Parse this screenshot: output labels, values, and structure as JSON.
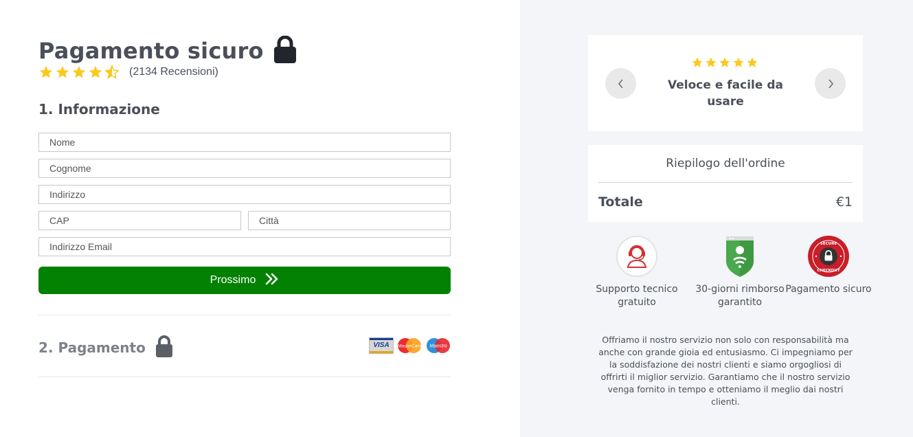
{
  "checkout": {
    "title": "Pagamento sicuro",
    "rating": 4.5,
    "reviews_text": "(2134 Recensioni)",
    "section1_title": "1. Informazione",
    "fields": {
      "nome": "Nome",
      "cognome": "Cognome",
      "indirizzo": "Indirizzo",
      "cap": "CAP",
      "citta": "Città",
      "email": "Indirizzo Email"
    },
    "next_button": "Prossimo",
    "section2_title": "2. Pagamento",
    "card_brands": [
      "VISA",
      "MasterCard",
      "Maestro"
    ]
  },
  "review_slider": {
    "stars": 5,
    "text": "Veloce e facile da usare"
  },
  "order_summary": {
    "title": "Riepilogo dell'ordine",
    "total_label": "Totale",
    "total_value": "€1"
  },
  "badges": [
    {
      "icon": "support-agent-icon",
      "label": "Supporto tecnico gratuito"
    },
    {
      "icon": "refund-shield-icon",
      "label": "30-giorni rimborso garantito"
    },
    {
      "icon": "secure-checkout-seal-icon",
      "label": "Pagamento sicuro",
      "seal_text": "SECURE CHECKOUT"
    }
  ],
  "about_text": "Offriamo il nostro servizio non solo con responsabilità ma anche con grande gioia ed entusiasmo. Ci impegniamo per la soddisfazione dei nostri clienti e siamo orgogliosi di offrirti il miglior servizio. Garantiamo che il nostro servizio venga fornito in tempo e otteniamo il meglio dai nostri clienti.",
  "colors": {
    "accent_green": "#038103",
    "star_yellow": "#f9c91e",
    "right_bg": "#f4f5f8",
    "text_dark": "#4a4f5a"
  }
}
